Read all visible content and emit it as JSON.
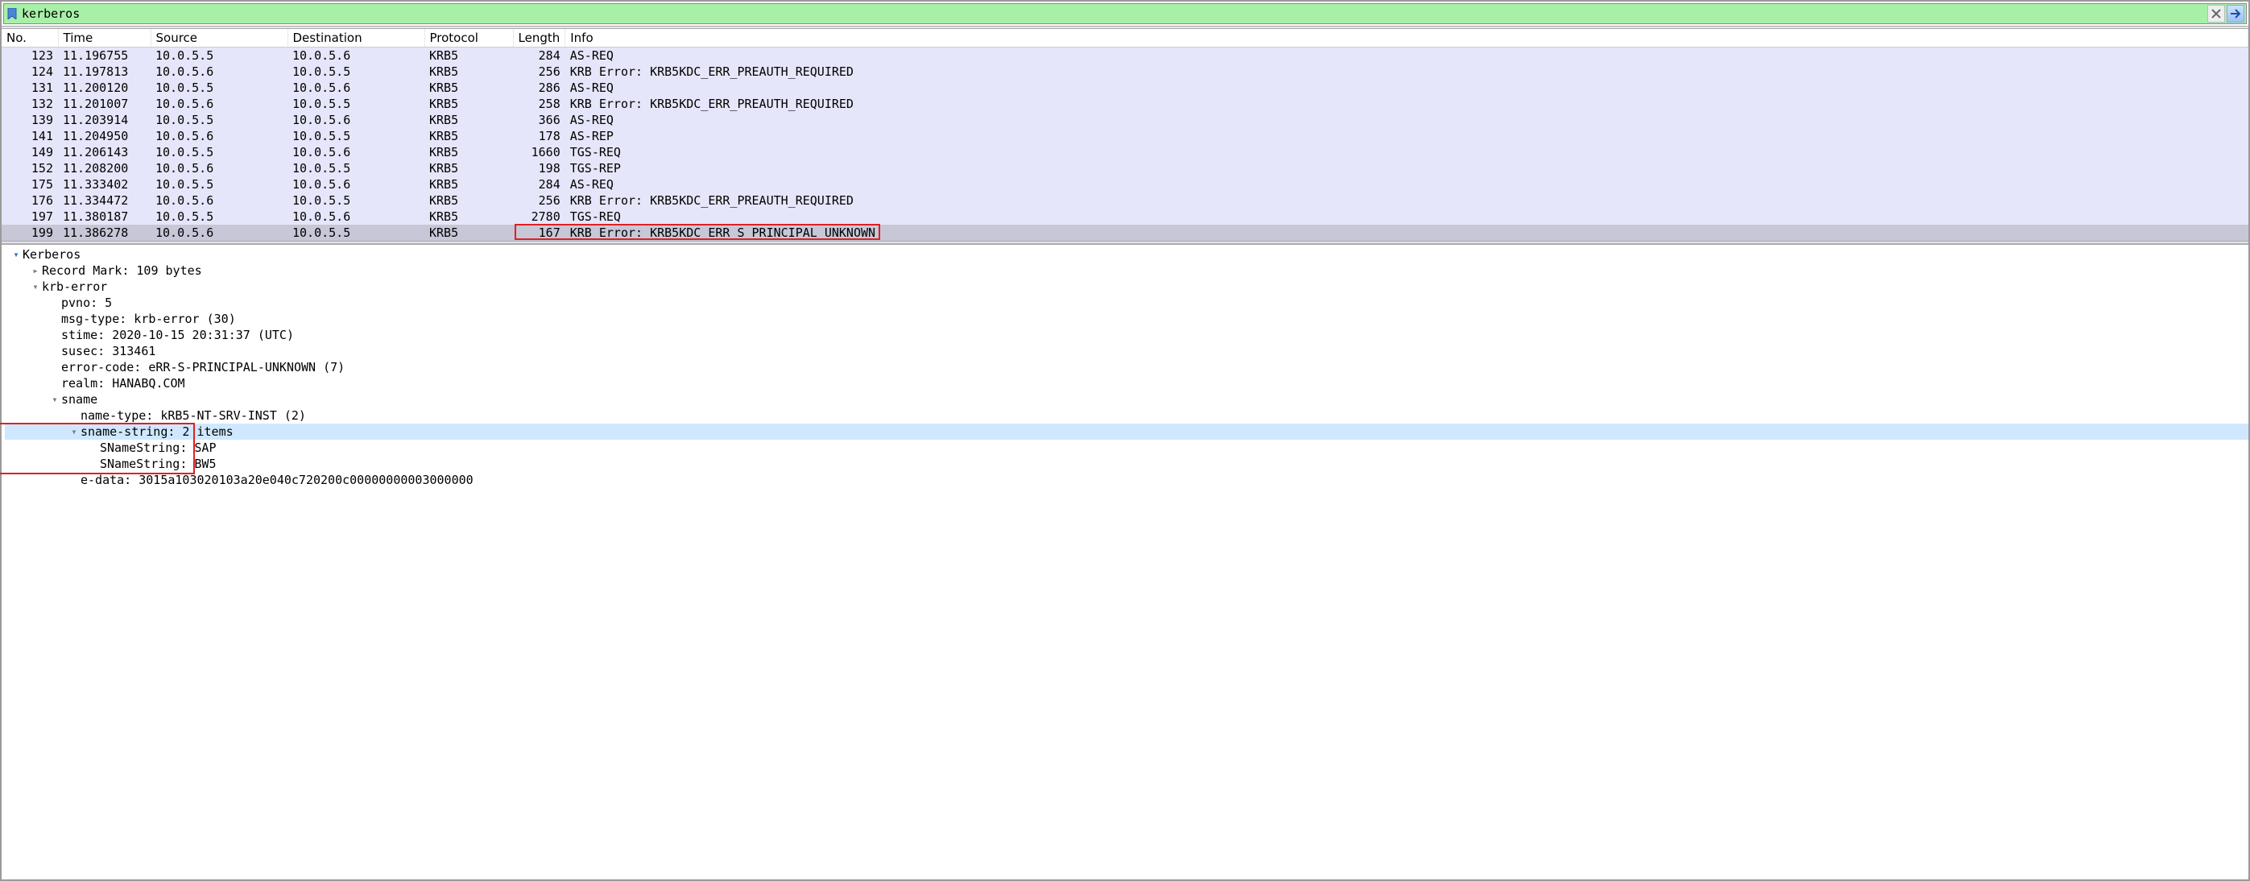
{
  "filter": {
    "value": "kerberos"
  },
  "columns": [
    "No.",
    "Time",
    "Source",
    "Destination",
    "Protocol",
    "Length",
    "Info"
  ],
  "packets": [
    {
      "no": "123",
      "time": "11.196755",
      "src": "10.0.5.5",
      "dst": "10.0.5.6",
      "proto": "KRB5",
      "len": "284",
      "info": "AS-REQ",
      "selected": false
    },
    {
      "no": "124",
      "time": "11.197813",
      "src": "10.0.5.6",
      "dst": "10.0.5.5",
      "proto": "KRB5",
      "len": "256",
      "info": "KRB Error: KRB5KDC_ERR_PREAUTH_REQUIRED",
      "selected": false
    },
    {
      "no": "131",
      "time": "11.200120",
      "src": "10.0.5.5",
      "dst": "10.0.5.6",
      "proto": "KRB5",
      "len": "286",
      "info": "AS-REQ",
      "selected": false
    },
    {
      "no": "132",
      "time": "11.201007",
      "src": "10.0.5.6",
      "dst": "10.0.5.5",
      "proto": "KRB5",
      "len": "258",
      "info": "KRB Error: KRB5KDC_ERR_PREAUTH_REQUIRED",
      "selected": false
    },
    {
      "no": "139",
      "time": "11.203914",
      "src": "10.0.5.5",
      "dst": "10.0.5.6",
      "proto": "KRB5",
      "len": "366",
      "info": "AS-REQ",
      "selected": false
    },
    {
      "no": "141",
      "time": "11.204950",
      "src": "10.0.5.6",
      "dst": "10.0.5.5",
      "proto": "KRB5",
      "len": "178",
      "info": "AS-REP",
      "selected": false
    },
    {
      "no": "149",
      "time": "11.206143",
      "src": "10.0.5.5",
      "dst": "10.0.5.6",
      "proto": "KRB5",
      "len": "1660",
      "info": "TGS-REQ",
      "selected": false
    },
    {
      "no": "152",
      "time": "11.208200",
      "src": "10.0.5.6",
      "dst": "10.0.5.5",
      "proto": "KRB5",
      "len": "198",
      "info": "TGS-REP",
      "selected": false
    },
    {
      "no": "175",
      "time": "11.333402",
      "src": "10.0.5.5",
      "dst": "10.0.5.6",
      "proto": "KRB5",
      "len": "284",
      "info": "AS-REQ",
      "selected": false
    },
    {
      "no": "176",
      "time": "11.334472",
      "src": "10.0.5.6",
      "dst": "10.0.5.5",
      "proto": "KRB5",
      "len": "256",
      "info": "KRB Error: KRB5KDC_ERR_PREAUTH_REQUIRED",
      "selected": false
    },
    {
      "no": "197",
      "time": "11.380187",
      "src": "10.0.5.5",
      "dst": "10.0.5.6",
      "proto": "KRB5",
      "len": "2780",
      "info": "TGS-REQ",
      "selected": false
    },
    {
      "no": "199",
      "time": "11.386278",
      "src": "10.0.5.6",
      "dst": "10.0.5.5",
      "proto": "KRB5",
      "len": "167",
      "info": "KRB Error: KRB5KDC_ERR_S_PRINCIPAL_UNKNOWN",
      "selected": true
    }
  ],
  "highlight_packet_index": 11,
  "detail": {
    "root": "Kerberos",
    "record_mark": "Record Mark: 109 bytes",
    "krb_error_label": "krb-error",
    "fields": {
      "pvno": "pvno: 5",
      "msg_type": "msg-type: krb-error (30)",
      "stime": "stime: 2020-10-15 20:31:37 (UTC)",
      "susec": "susec: 313461",
      "error_code": "error-code: eRR-S-PRINCIPAL-UNKNOWN (7)",
      "realm": "realm: HANABQ.COM",
      "sname_label": "sname",
      "name_type": "name-type: kRB5-NT-SRV-INST (2)",
      "sname_string_label": "sname-string: 2 items",
      "sname_item_0": "SNameString: SAP",
      "sname_item_1": "SNameString: BW5",
      "e_data": "e-data: 3015a103020103a20e040c720200c00000000003000000"
    }
  }
}
